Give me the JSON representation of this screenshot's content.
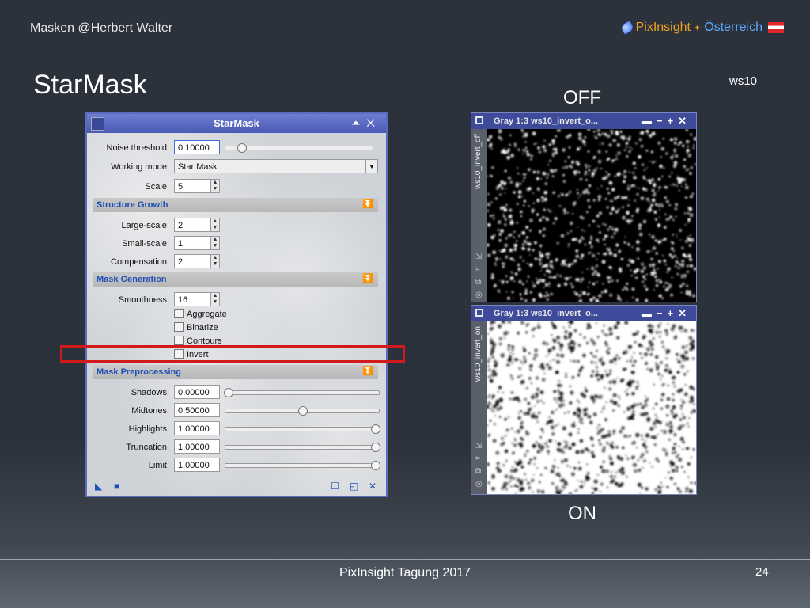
{
  "header": {
    "title": "Masken  @Herbert Walter",
    "brand": "PixInsight",
    "country": "Österreich"
  },
  "slide": {
    "title": "StarMask",
    "tag": "ws10",
    "off_label": "OFF",
    "on_label": "ON"
  },
  "footer": {
    "text": "PixInsight Tagung 2017",
    "page": "24"
  },
  "dialog": {
    "title": "StarMask",
    "noise_threshold": {
      "label": "Noise threshold:",
      "value": "0.10000"
    },
    "working_mode": {
      "label": "Working mode:",
      "value": "Star Mask"
    },
    "scale": {
      "label": "Scale:",
      "value": "5"
    },
    "structure_growth": {
      "title": "Structure Growth",
      "large_scale": {
        "label": "Large-scale:",
        "value": "2"
      },
      "small_scale": {
        "label": "Small-scale:",
        "value": "1"
      },
      "compensation": {
        "label": "Compensation:",
        "value": "2"
      }
    },
    "mask_generation": {
      "title": "Mask Generation",
      "smoothness": {
        "label": "Smoothness:",
        "value": "16"
      },
      "checkboxes": [
        "Aggregate",
        "Binarize",
        "Contours",
        "Invert"
      ]
    },
    "mask_preprocessing": {
      "title": "Mask Preprocessing",
      "shadows": {
        "label": "Shadows:",
        "value": "0.00000"
      },
      "midtones": {
        "label": "Midtones:",
        "value": "0.50000"
      },
      "highlights": {
        "label": "Highlights:",
        "value": "1.00000"
      },
      "truncation": {
        "label": "Truncation:",
        "value": "1.00000"
      },
      "limit": {
        "label": "Limit:",
        "value": "1.00000"
      }
    }
  },
  "windows": {
    "off": {
      "title": "Gray 1:3 ws10_invert_o...",
      "id": "ws10_invert_off"
    },
    "on": {
      "title": "Gray 1:3 ws10_invert_o...",
      "id": "ws10_invert_on"
    }
  },
  "colors": {
    "highlight": "#d21a1a",
    "accent": "#1d4fb5"
  }
}
